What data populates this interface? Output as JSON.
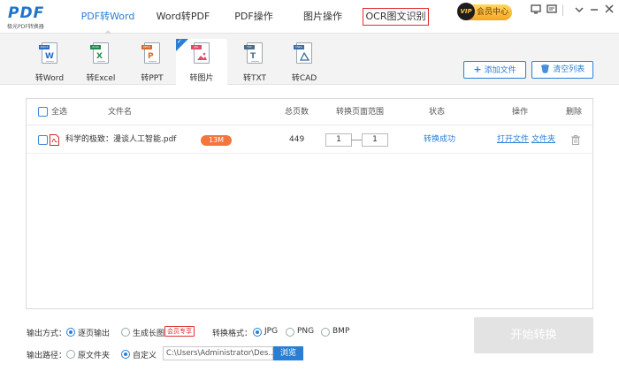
{
  "app": {
    "logo_text": "PDF",
    "logo_sub": "极光PDF转换器"
  },
  "nav": {
    "tabs": [
      {
        "label": "PDF转Word",
        "active": true
      },
      {
        "label": "Word转PDF"
      },
      {
        "label": "PDF操作"
      },
      {
        "label": "图片操作"
      },
      {
        "label": "OCR图文识别",
        "highlighted": true
      }
    ],
    "vip_label": "会员中心",
    "vip_badge": "VIP"
  },
  "toolbar": {
    "tools": [
      {
        "label": "转Word",
        "icon": "word-doc-icon",
        "tag": "DOCX",
        "color": "#2b6cc4"
      },
      {
        "label": "转Excel",
        "icon": "excel-doc-icon",
        "tag": "XLSX",
        "color": "#1e8c45"
      },
      {
        "label": "转PPT",
        "icon": "ppt-doc-icon",
        "tag": "PPTX",
        "color": "#e0692a"
      },
      {
        "label": "转图片",
        "icon": "image-doc-icon",
        "tag": "JPG",
        "color": "#e04a6a",
        "active": true
      },
      {
        "label": "转TXT",
        "icon": "txt-doc-icon",
        "tag": "TXT",
        "color": "#4a6d8c"
      },
      {
        "label": "转CAD",
        "icon": "cad-doc-icon",
        "tag": "DWG",
        "color": "#3a6ea5"
      }
    ],
    "add_file": "添加文件",
    "clear_list": "清空列表"
  },
  "table": {
    "headers": {
      "select_all": "全选",
      "filename": "文件名",
      "total_pages": "总页数",
      "page_range": "转换页面范围",
      "status": "状态",
      "actions": "操作",
      "delete": "删除"
    },
    "rows": [
      {
        "filename": "科学的极致：漫谈人工智能.pdf",
        "size": "13M",
        "pages": "449",
        "range_from": "1",
        "range_to": "1",
        "status": "转换成功",
        "open_file": "打开文件",
        "open_folder": "文件夹"
      }
    ]
  },
  "options": {
    "output_mode_label": "输出方式：",
    "per_page": "逐页输出",
    "long_image": "生成长图",
    "vip_only": "会员专享",
    "format_label": "转换格式：",
    "formats": [
      "JPG",
      "PNG",
      "BMP"
    ],
    "selected_format": "JPG",
    "output_path_label": "输出路径：",
    "original_folder": "原文件夹",
    "custom": "自定义",
    "path_value": "C:\\Users\\Administrator\\Des...",
    "browse": "浏览",
    "start": "开始转换"
  },
  "colors": {
    "accent": "#2a7fd4",
    "size_badge": "#f4763c",
    "ocr_border": "#e03030"
  }
}
